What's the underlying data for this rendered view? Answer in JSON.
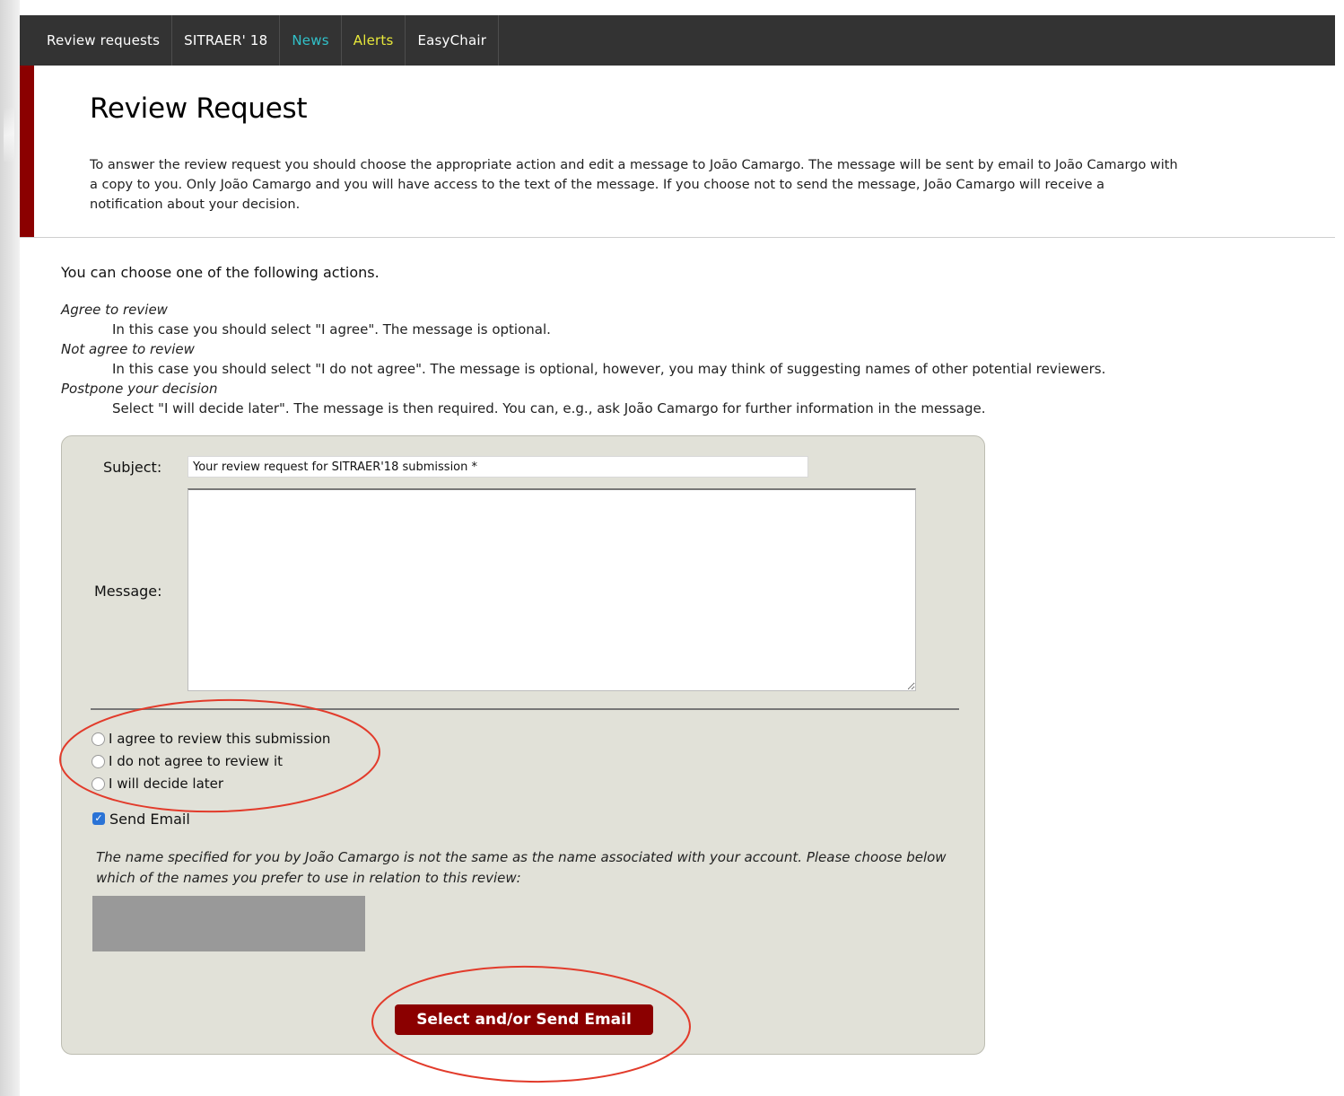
{
  "nav": {
    "items": [
      {
        "label": "Review requests",
        "color": "#ffffff"
      },
      {
        "label": "SITRAER' 18",
        "color": "#ffffff"
      },
      {
        "label": "News",
        "color": "#31c1c9"
      },
      {
        "label": "Alerts",
        "color": "#e8e83a"
      },
      {
        "label": "EasyChair",
        "color": "#ffffff"
      }
    ]
  },
  "header": {
    "title": "Review Request",
    "intro": "To answer the review request you should choose the appropriate action and edit a message to João Camargo. The message will be sent by email to João Camargo with a copy to you. Only João Camargo and you will have access to the text of the message. If you choose not to send the message, João Camargo will receive a notification about your decision."
  },
  "actions": {
    "intro": "You can choose one of the following actions.",
    "list": [
      {
        "term": "Agree to review",
        "desc": "In this case you should select \"I agree\". The message is optional."
      },
      {
        "term": "Not agree to review",
        "desc": "In this case you should select \"I do not agree\". The message is optional, however, you may think of suggesting names of other potential reviewers."
      },
      {
        "term": "Postpone your decision",
        "desc": "Select \"I will decide later\". The message is then required. You can, e.g., ask João Camargo for further information in the message."
      }
    ]
  },
  "form": {
    "subject_label": "Subject:",
    "subject_value": "Your review request for SITRAER'18 submission *",
    "message_label": "Message:",
    "message_value": "",
    "radios": [
      {
        "label": "I agree to review this submission"
      },
      {
        "label": "I do not agree to review it"
      },
      {
        "label": "I will decide later"
      }
    ],
    "send_email_label": "Send Email",
    "send_email_checked": true,
    "name_note": "The name specified for you by João Camargo is not the same as the name associated with your account. Please choose below which of the names you prefer to use in relation to this review:",
    "submit_label": "Select and/or Send Email"
  },
  "colors": {
    "nav_bg": "#333333",
    "accent": "#8b0000",
    "form_bg": "#e1e1d8",
    "annotation": "#e23b2b"
  }
}
